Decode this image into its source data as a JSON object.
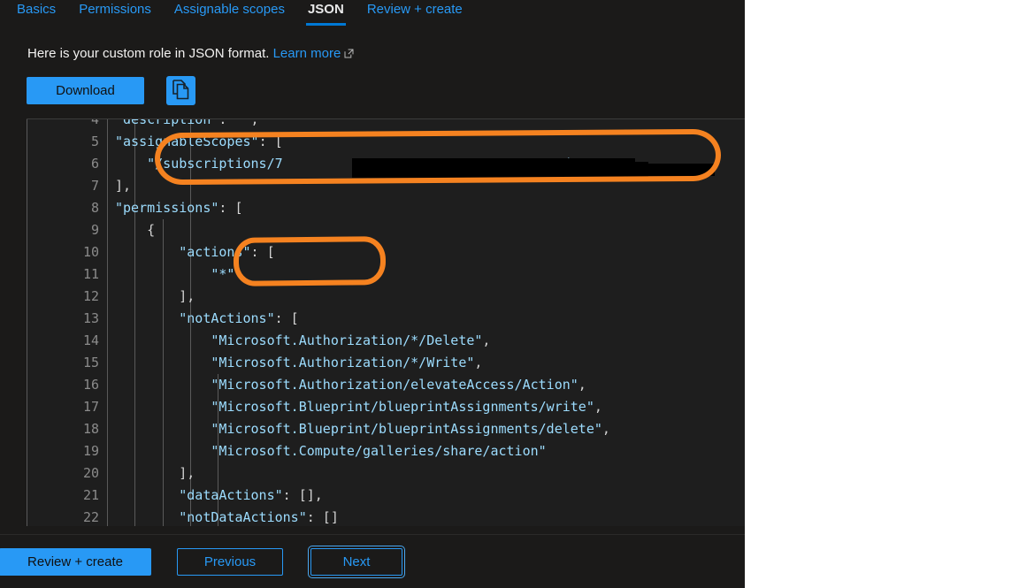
{
  "tabs": [
    {
      "label": "Basics",
      "active": false
    },
    {
      "label": "Permissions",
      "active": false
    },
    {
      "label": "Assignable scopes",
      "active": false
    },
    {
      "label": "JSON",
      "active": true
    },
    {
      "label": "Review + create",
      "active": false
    }
  ],
  "intro": {
    "text": "Here is your custom role in JSON format.",
    "link_label": "Learn more",
    "link_icon": "external-link-icon"
  },
  "commands": {
    "download_label": "Download",
    "copy_icon": "copy-icon"
  },
  "editor": {
    "lines": [
      {
        "no": "4",
        "text": "\"description\": \"\","
      },
      {
        "no": "5",
        "text": "\"assignableScopes\": ["
      },
      {
        "no": "6",
        "text": "    \"/subscriptions/7                                   d\""
      },
      {
        "no": "7",
        "text": "],"
      },
      {
        "no": "8",
        "text": "\"permissions\": ["
      },
      {
        "no": "9",
        "text": "    {"
      },
      {
        "no": "10",
        "text": "        \"actions\": ["
      },
      {
        "no": "11",
        "text": "            \"*\""
      },
      {
        "no": "12",
        "text": "        ],"
      },
      {
        "no": "13",
        "text": "        \"notActions\": ["
      },
      {
        "no": "14",
        "text": "            \"Microsoft.Authorization/*/Delete\","
      },
      {
        "no": "15",
        "text": "            \"Microsoft.Authorization/*/Write\","
      },
      {
        "no": "16",
        "text": "            \"Microsoft.Authorization/elevateAccess/Action\","
      },
      {
        "no": "17",
        "text": "            \"Microsoft.Blueprint/blueprintAssignments/write\","
      },
      {
        "no": "18",
        "text": "            \"Microsoft.Blueprint/blueprintAssignments/delete\","
      },
      {
        "no": "19",
        "text": "            \"Microsoft.Compute/galleries/share/action\""
      },
      {
        "no": "20",
        "text": "        ],"
      },
      {
        "no": "21",
        "text": "        \"dataActions\": [],"
      },
      {
        "no": "22",
        "text": "        \"notDataActions\": []"
      }
    ]
  },
  "annotations": [
    {
      "name": "assignable-scopes-highlight",
      "shape": "ellipse"
    },
    {
      "name": "actions-highlight",
      "shape": "rounded-rect"
    }
  ],
  "footer": {
    "review_create_label": "Review + create",
    "previous_label": "Previous",
    "next_label": "Next"
  },
  "colors": {
    "accent": "#2899f5",
    "annotation": "#f58220",
    "editor_bg": "#1e1e1e",
    "panel_bg": "#1b1a19",
    "json_key": "#9cdcfe"
  }
}
